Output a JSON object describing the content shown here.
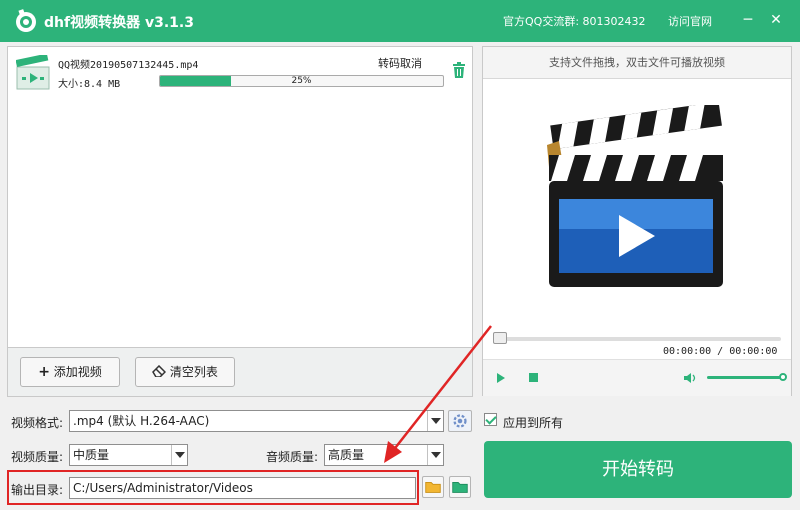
{
  "app": {
    "title": "dhf视频转换器 v3.1.3",
    "qq_group": "官方QQ交流群: 801302432",
    "visit_site": "访问官网",
    "minimize_glyph": "─",
    "close_glyph": "✕"
  },
  "file_list": {
    "items": [
      {
        "name": "QQ视频20190507132445.mp4",
        "size_label": "大小:8.4 MB",
        "progress": 0.25,
        "progress_text": "25%",
        "cancel_label": "转码取消"
      }
    ],
    "add_button": "添加视频",
    "add_glyph": "+",
    "clear_button": "清空列表"
  },
  "preview": {
    "hint": "支持文件拖拽，双击文件可播放视频",
    "time": "00:00:00 / 00:00:00",
    "volume": 1.0
  },
  "settings": {
    "format_label": "视频格式:",
    "format_value": ".mp4 (默认 H.264-AAC)",
    "apply_all_label": "应用到所有",
    "apply_all_checked": true,
    "video_quality_label": "视频质量:",
    "video_quality_value": "中质量",
    "audio_quality_label": "音频质量:",
    "audio_quality_value": "高质量",
    "output_dir_label": "输出目录:",
    "output_dir_value": "C:/Users/Administrator/Videos"
  },
  "start_button": "开始转码",
  "colors": {
    "accent": "#2db37a",
    "annotation": "#e02525"
  }
}
